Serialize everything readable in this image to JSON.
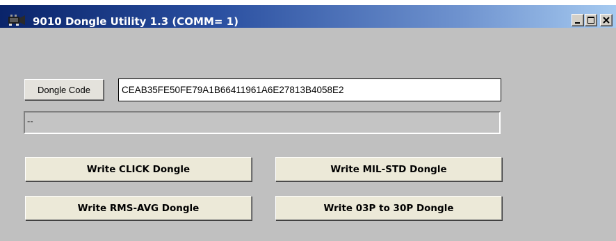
{
  "window": {
    "title": "9010 Dongle Utility 1.3 (COMM= 1)",
    "icon": "app-icon",
    "controls": {
      "minimize_glyph": "minimize-icon",
      "maximize_glyph": "maximize-icon",
      "close_glyph": "close-icon"
    }
  },
  "dongle": {
    "button_label": "Dongle Code",
    "code_value": "CEAB35FE50FE79A1B66411961A6E27813B4058E2"
  },
  "status": {
    "text": "--"
  },
  "actions": [
    {
      "label": "Write CLICK Dongle"
    },
    {
      "label": "Write MIL-STD Dongle"
    },
    {
      "label": "Write RMS-AVG Dongle"
    },
    {
      "label": "Write 03P to 30P Dongle"
    }
  ],
  "colors": {
    "titlebar_start": "#0a246a",
    "titlebar_end": "#a6caf0",
    "window_bg": "#c0c0c0",
    "button_face": "#ece9d8"
  }
}
